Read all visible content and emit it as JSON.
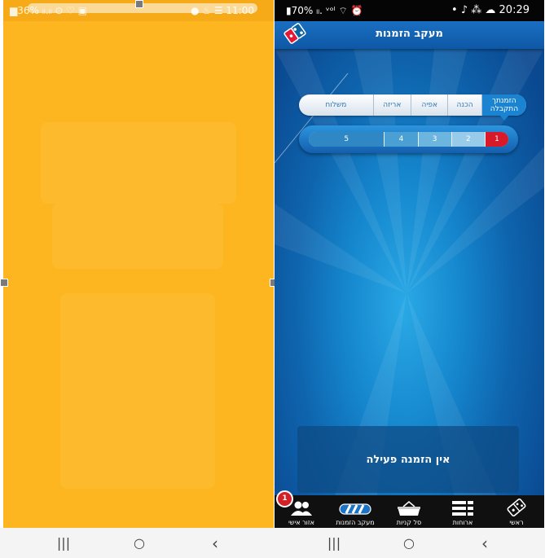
{
  "left_panel": {
    "status_left": "▆36% ₗₗ.ₗₗ ⊙ ♡ ▣",
    "status_right": "● ♨ ☰ 11:00",
    "color": "#fdb61f"
  },
  "right_panel": {
    "status_left": "▮70% ₗₗ. ᵛᵒˡ ⌔ ⏰",
    "status_right": "• ♪ ⁂ ☁ 20:29",
    "title": "מעקב הזמנות",
    "steps": [
      "משלוח",
      "אריזה",
      "אפיה",
      "הכנה",
      "הזמנתך התקבלה"
    ],
    "progress_numbers": [
      "5",
      "4",
      "3",
      "2",
      "1"
    ],
    "no_order_message": "אין הזמנה פעילה",
    "nav": [
      {
        "label": "אזור אישי",
        "icon": "people-icon",
        "badge": "1"
      },
      {
        "label": "מעקב הזמנות",
        "icon": "tracking-bar-icon"
      },
      {
        "label": "סל קניות",
        "icon": "basket-icon"
      },
      {
        "label": "ארוחות",
        "icon": "menu-list-icon"
      },
      {
        "label": "ראשי",
        "icon": "dominos-logo-icon"
      }
    ],
    "colors": {
      "accent": "#1a84d2",
      "active_step": "#d7192a",
      "bar_light": "#9fd0ec"
    }
  },
  "system_nav": {
    "recent": "|||",
    "home": "○",
    "back": "‹"
  }
}
